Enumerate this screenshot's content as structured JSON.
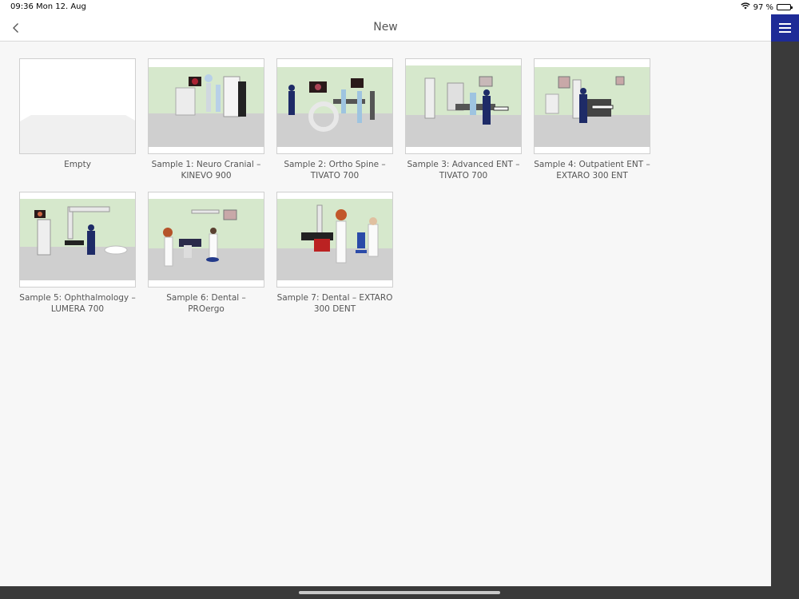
{
  "status": {
    "time": "09:36",
    "date": "Mon 12. Aug",
    "battery": "97 %"
  },
  "nav": {
    "title": "New"
  },
  "templates": [
    {
      "line1": "Empty",
      "line2": ""
    },
    {
      "line1": "Sample 1: Neuro Cranial –",
      "line2": "KINEVO 900"
    },
    {
      "line1": "Sample 2: Ortho Spine –",
      "line2": "TIVATO 700"
    },
    {
      "line1": "Sample 3: Advanced ENT –",
      "line2": "TIVATO 700"
    },
    {
      "line1": "Sample 4: Outpatient ENT –",
      "line2": "EXTARO 300 ENT"
    },
    {
      "line1": "Sample 5: Ophthalmology –",
      "line2": "LUMERA 700"
    },
    {
      "line1": "Sample 6: Dental – PROergo",
      "line2": ""
    },
    {
      "line1": "Sample 7: Dental – EXTARO",
      "line2": "300 DENT"
    }
  ],
  "colors": {
    "accent": "#1e2b97",
    "wall": "#d6e8cc",
    "floor": "#cfcfcf"
  }
}
